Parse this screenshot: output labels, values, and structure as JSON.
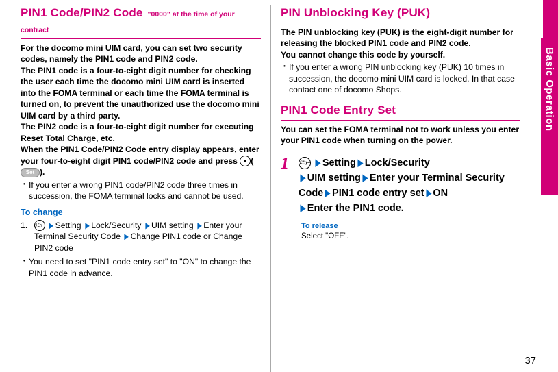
{
  "sidetab": "Basic Operation",
  "pagenum": "37",
  "left": {
    "title": "PIN1 Code/PIN2 Code",
    "titleSub": "\"0000\" at the time of your contract",
    "p1": "For the docomo mini UIM card, you can set two security codes, namely the PIN1 code and PIN2 code.",
    "p2": "The PIN1 code is a four-to-eight digit number for checking the user each time the docomo mini UIM card is inserted into the FOMA terminal or each time the FOMA terminal is turned on, to prevent the unauthorized use the docomo mini UIM card by a third party.",
    "p3": "The PIN2 code is a four-to-eight digit number for executing Reset Total Charge, etc.",
    "p4a": "When the PIN1 Code/PIN2 Code entry display appears, enter your four-to-eight digit PIN1 code/PIN2 code and press ",
    "iconSet": "Set",
    "p4b": ").",
    "b1": "If you enter a wrong PIN1 code/PIN2 code three times in succession, the FOMA terminal locks and cannot be used.",
    "changeHead": "To change",
    "changeStep1Prefix": "1.",
    "iconMenu": "ﾒﾆｭｰ",
    "nav": [
      "Setting",
      "Lock/Security",
      "UIM setting",
      "Enter your Terminal Security Code",
      "Change PIN1 code or Change PIN2 code"
    ],
    "b2": "You need to set \"PIN1 code entry set\" to \"ON\" to change the PIN1 code in advance."
  },
  "right": {
    "pukTitle": "PIN Unblocking Key (PUK)",
    "pukP1": "The PIN unblocking key (PUK) is the eight-digit number for releasing the blocked PIN1 code and PIN2 code.",
    "pukP2": "You cannot change this code by yourself.",
    "pukB1": "If you enter a wrong PIN unblocking key (PUK) 10 times in succession, the docomo mini UIM card is locked. In that case contact one of docomo Shops.",
    "entryTitle": "PIN1 Code Entry Set",
    "entryP1": "You can set the FOMA terminal not to work unless you enter your PIN1 code when turning on the power.",
    "stepNum": "1",
    "iconMenu": "ﾒﾆｭｰ",
    "stepNav": [
      "Setting",
      "Lock/Security",
      "UIM setting",
      "Enter your Terminal Security Code",
      "PIN1 code entry set",
      "ON",
      "Enter the PIN1 code."
    ],
    "releaseHead": "To release",
    "releaseText": "Select \"OFF\"."
  }
}
